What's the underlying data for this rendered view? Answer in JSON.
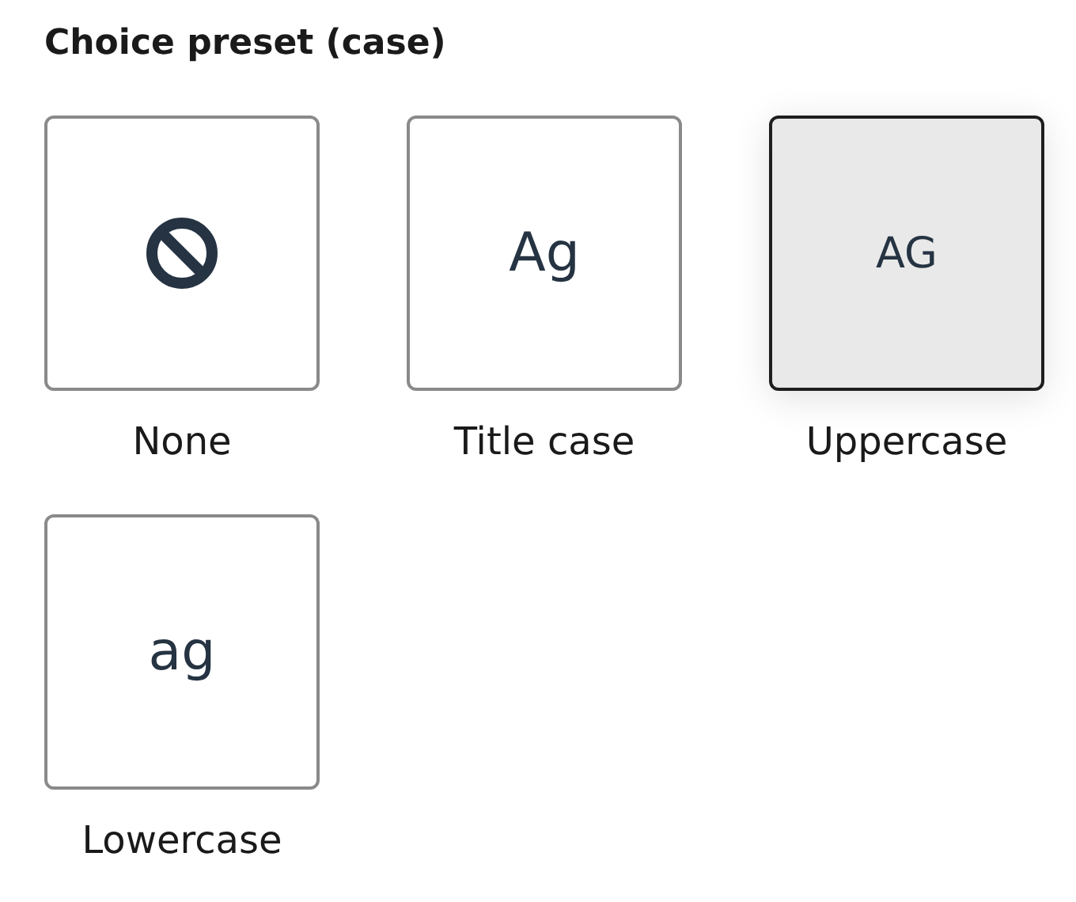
{
  "title": "Choice preset (case)",
  "options": [
    {
      "kind": "icon",
      "label": "None",
      "selected": false
    },
    {
      "kind": "text",
      "preview": "Ag",
      "label": "Title case",
      "selected": false
    },
    {
      "kind": "text",
      "preview": "AG",
      "label": "Uppercase",
      "selected": true
    },
    {
      "kind": "text",
      "preview": "ag",
      "label": "Lowercase",
      "selected": false
    }
  ]
}
